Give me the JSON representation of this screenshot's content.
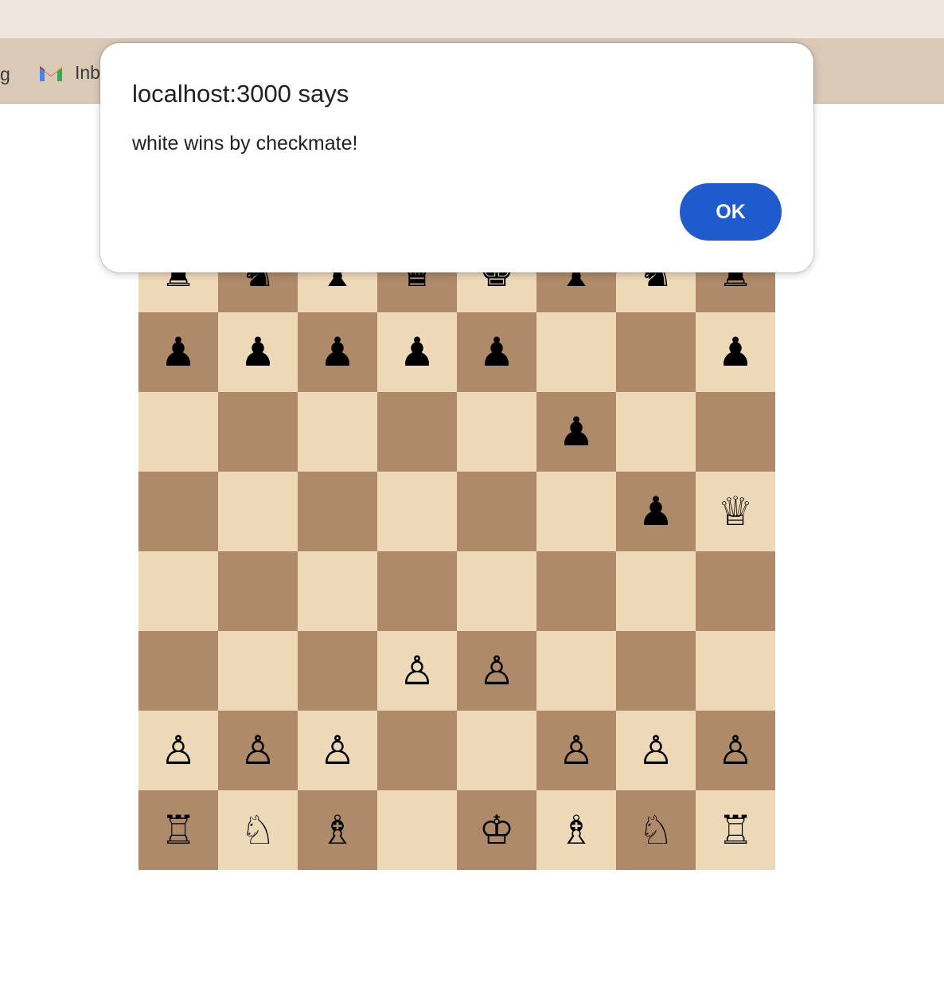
{
  "browser": {
    "bookmark_partial_left": "g",
    "bookmark_gmail_label": "Inb"
  },
  "dialog": {
    "title": "localhost:3000 says",
    "message": "white wins by checkmate!",
    "ok_label": "OK",
    "ok_color": "#1f5bcc"
  },
  "board": {
    "light_color": "#edd9b8",
    "dark_color": "#ae8a69",
    "ranks": [
      [
        "♜",
        "♞",
        "♝",
        "♛",
        "♚",
        "♝",
        "♞",
        "♜"
      ],
      [
        "♟",
        "♟",
        "♟",
        "♟",
        "♟",
        "",
        "",
        "♟"
      ],
      [
        "",
        "",
        "",
        "",
        "",
        "♟",
        "",
        ""
      ],
      [
        "",
        "",
        "",
        "",
        "",
        "",
        "♟",
        "♕"
      ],
      [
        "",
        "",
        "",
        "",
        "",
        "",
        "",
        ""
      ],
      [
        "",
        "",
        "",
        "♙",
        "♙",
        "",
        "",
        ""
      ],
      [
        "♙",
        "♙",
        "♙",
        "",
        "",
        "♙",
        "♙",
        "♙"
      ],
      [
        "♖",
        "♘",
        "♗",
        "",
        "♔",
        "♗",
        "♘",
        "♖"
      ]
    ]
  }
}
